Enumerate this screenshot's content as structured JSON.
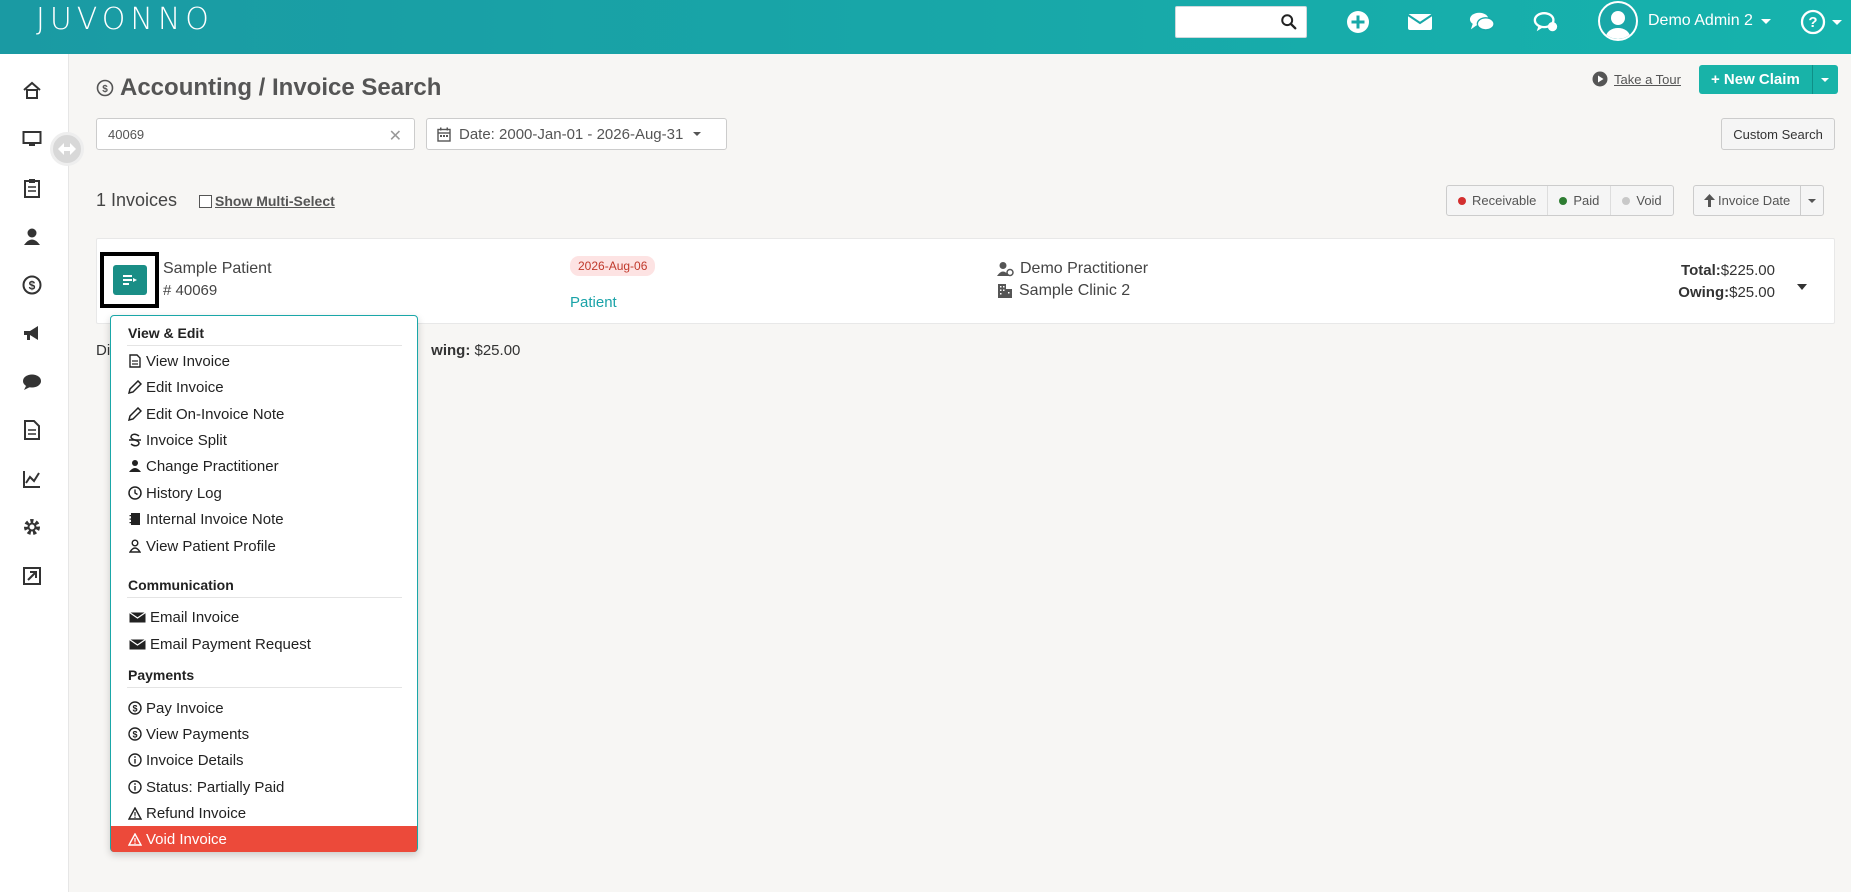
{
  "brand": {
    "logo_text": "JUVONNO"
  },
  "topbar": {
    "search_placeholder": "",
    "icons": [
      "add-circle-icon",
      "mail-icon",
      "chat-icon",
      "support-chat-icon"
    ],
    "user_name": "Demo Admin 2",
    "help_icon": "question-circle-icon"
  },
  "sidebar": {
    "items": [
      "home-icon",
      "desktop-icon",
      "clipboard-icon",
      "patients-icon",
      "billing-dollar-icon",
      "megaphone-icon",
      "messages-icon",
      "document-icon",
      "reports-chart-icon",
      "settings-gear-icon",
      "external-link-icon"
    ]
  },
  "header": {
    "title": "Accounting / Invoice Search",
    "take_tour": "Take a Tour",
    "new_claim": "+ New Claim",
    "custom_search": "Custom Search"
  },
  "filters": {
    "search_value": "40069",
    "date_label": "Date: 2000-Jan-01 - 2026-Aug-31"
  },
  "results": {
    "count_label": "1 Invoices",
    "multi_select": "Show Multi-Select",
    "status_buttons": [
      {
        "label": "Receivable",
        "color": "#d32f2f"
      },
      {
        "label": "Paid",
        "color": "#2e7d32"
      },
      {
        "label": "Void",
        "color": "#c8c8c8"
      }
    ],
    "sort_label": "Invoice Date"
  },
  "invoice": {
    "patient": "Sample Patient",
    "number": "# 40069",
    "date": "2026-Aug-06",
    "payer_type": "Patient",
    "practitioner": "Demo Practitioner",
    "clinic": "Sample Clinic 2",
    "total_label": "Total:",
    "total_value": "$225.00",
    "owing_label": "Owing:",
    "owing_value": "$25.00"
  },
  "summary": {
    "left": "Di",
    "owing_label": "wing:",
    "owing_value": "$25.00"
  },
  "menu": {
    "sections": [
      {
        "heading": "View & Edit",
        "items": [
          {
            "label": "View Invoice",
            "icon": "file-text-icon"
          },
          {
            "label": "Edit Invoice",
            "icon": "pencil-icon"
          },
          {
            "label": "Edit On-Invoice Note",
            "icon": "pencil-icon"
          },
          {
            "label": "Invoice Split",
            "icon": "strikethrough-icon"
          },
          {
            "label": "Change Practitioner",
            "icon": "user-icon"
          },
          {
            "label": "History Log",
            "icon": "clock-icon"
          },
          {
            "label": "Internal Invoice Note",
            "icon": "notebook-icon"
          },
          {
            "label": "View Patient Profile",
            "icon": "person-outline-icon"
          }
        ]
      },
      {
        "heading": "Communication",
        "items": [
          {
            "label": "Email Invoice",
            "icon": "envelope-icon"
          },
          {
            "label": "Email Payment Request",
            "icon": "envelope-icon"
          }
        ]
      },
      {
        "heading": "Payments",
        "items": [
          {
            "label": "Pay Invoice",
            "icon": "dollar-circle-icon"
          },
          {
            "label": "View Payments",
            "icon": "dollar-circle-icon"
          },
          {
            "label": "Invoice Details",
            "icon": "info-circle-icon"
          },
          {
            "label": "Status: Partially Paid",
            "icon": "info-circle-icon"
          },
          {
            "label": "Refund Invoice",
            "icon": "warning-icon"
          },
          {
            "label": "Void Invoice",
            "icon": "warning-icon"
          }
        ]
      }
    ]
  }
}
